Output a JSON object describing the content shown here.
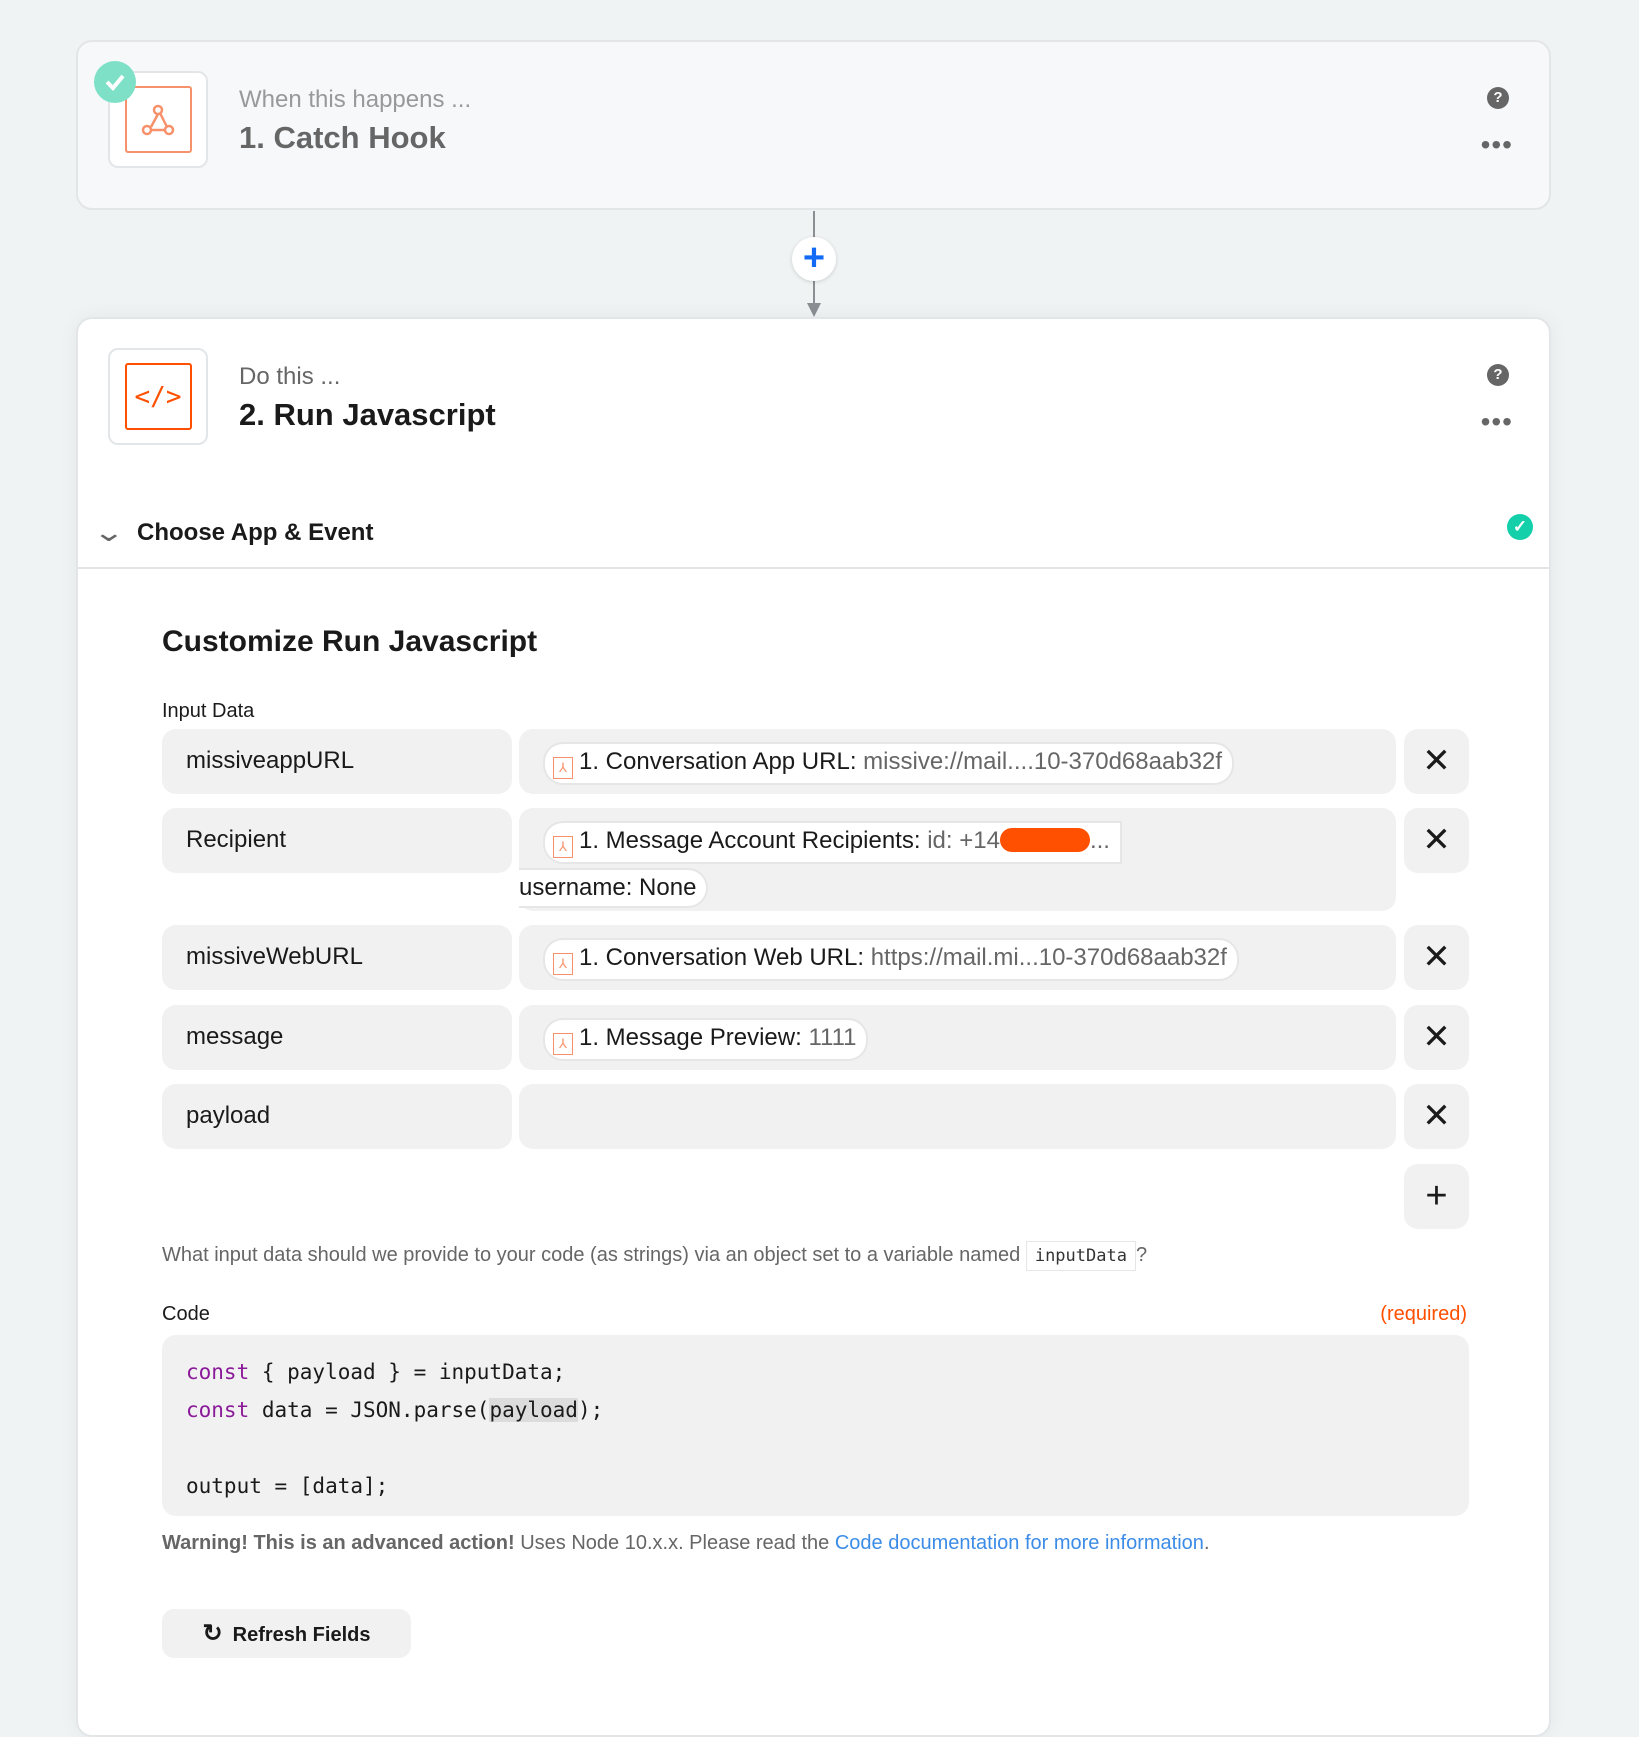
{
  "trigger": {
    "subtitle": "When this happens ...",
    "title": "1. Catch Hook",
    "icon": "webhook-icon",
    "status": "complete"
  },
  "action": {
    "subtitle": "Do this ...",
    "title": "2. Run Javascript",
    "icon": "code-icon"
  },
  "section": {
    "label": "Choose App & Event",
    "status": "complete"
  },
  "customize": {
    "heading": "Customize Run Javascript",
    "input_label": "Input Data",
    "rows": [
      {
        "key": "missiveappURL",
        "pill_label": "1. Conversation App URL:",
        "pill_value": "missive://mail....10-370d68aab32f"
      },
      {
        "key": "Recipient",
        "pill_label": "1. Message Account Recipients:",
        "pill_value": "id: +14",
        "pill_tail": "...",
        "extra": "username: None"
      },
      {
        "key": "missiveWebURL",
        "pill_label": "1. Conversation Web URL:",
        "pill_value": "https://mail.mi...10-370d68aab32f"
      },
      {
        "key": "message",
        "pill_label": "1. Message Preview:",
        "pill_value": "1111"
      },
      {
        "key": "payload"
      }
    ],
    "remove_symbol": "✕",
    "add_symbol": "+",
    "help_text": "What input data should we provide to your code (as strings) via an object set to a variable named",
    "help_code": "inputData",
    "help_end": "?",
    "code_label": "Code",
    "required": "(required)",
    "code": {
      "l1a": "const",
      "l1b": " { payload } = inputData;",
      "l2a": "const",
      "l2b": " data = JSON.parse(",
      "l2c": "payload",
      "l2d": ");",
      "l4": "output = [data];"
    },
    "warning_bold": "Warning! This is an advanced action!",
    "warning_text": " Uses Node 10.x.x. Please read the ",
    "warning_link": "Code documentation for more information",
    "warning_end": ".",
    "refresh": "Refresh Fields"
  },
  "colors": {
    "accent": "#ff4f00",
    "success": "#13d0ab",
    "link": "#3c8ce7",
    "add_step": "#136bf5"
  }
}
